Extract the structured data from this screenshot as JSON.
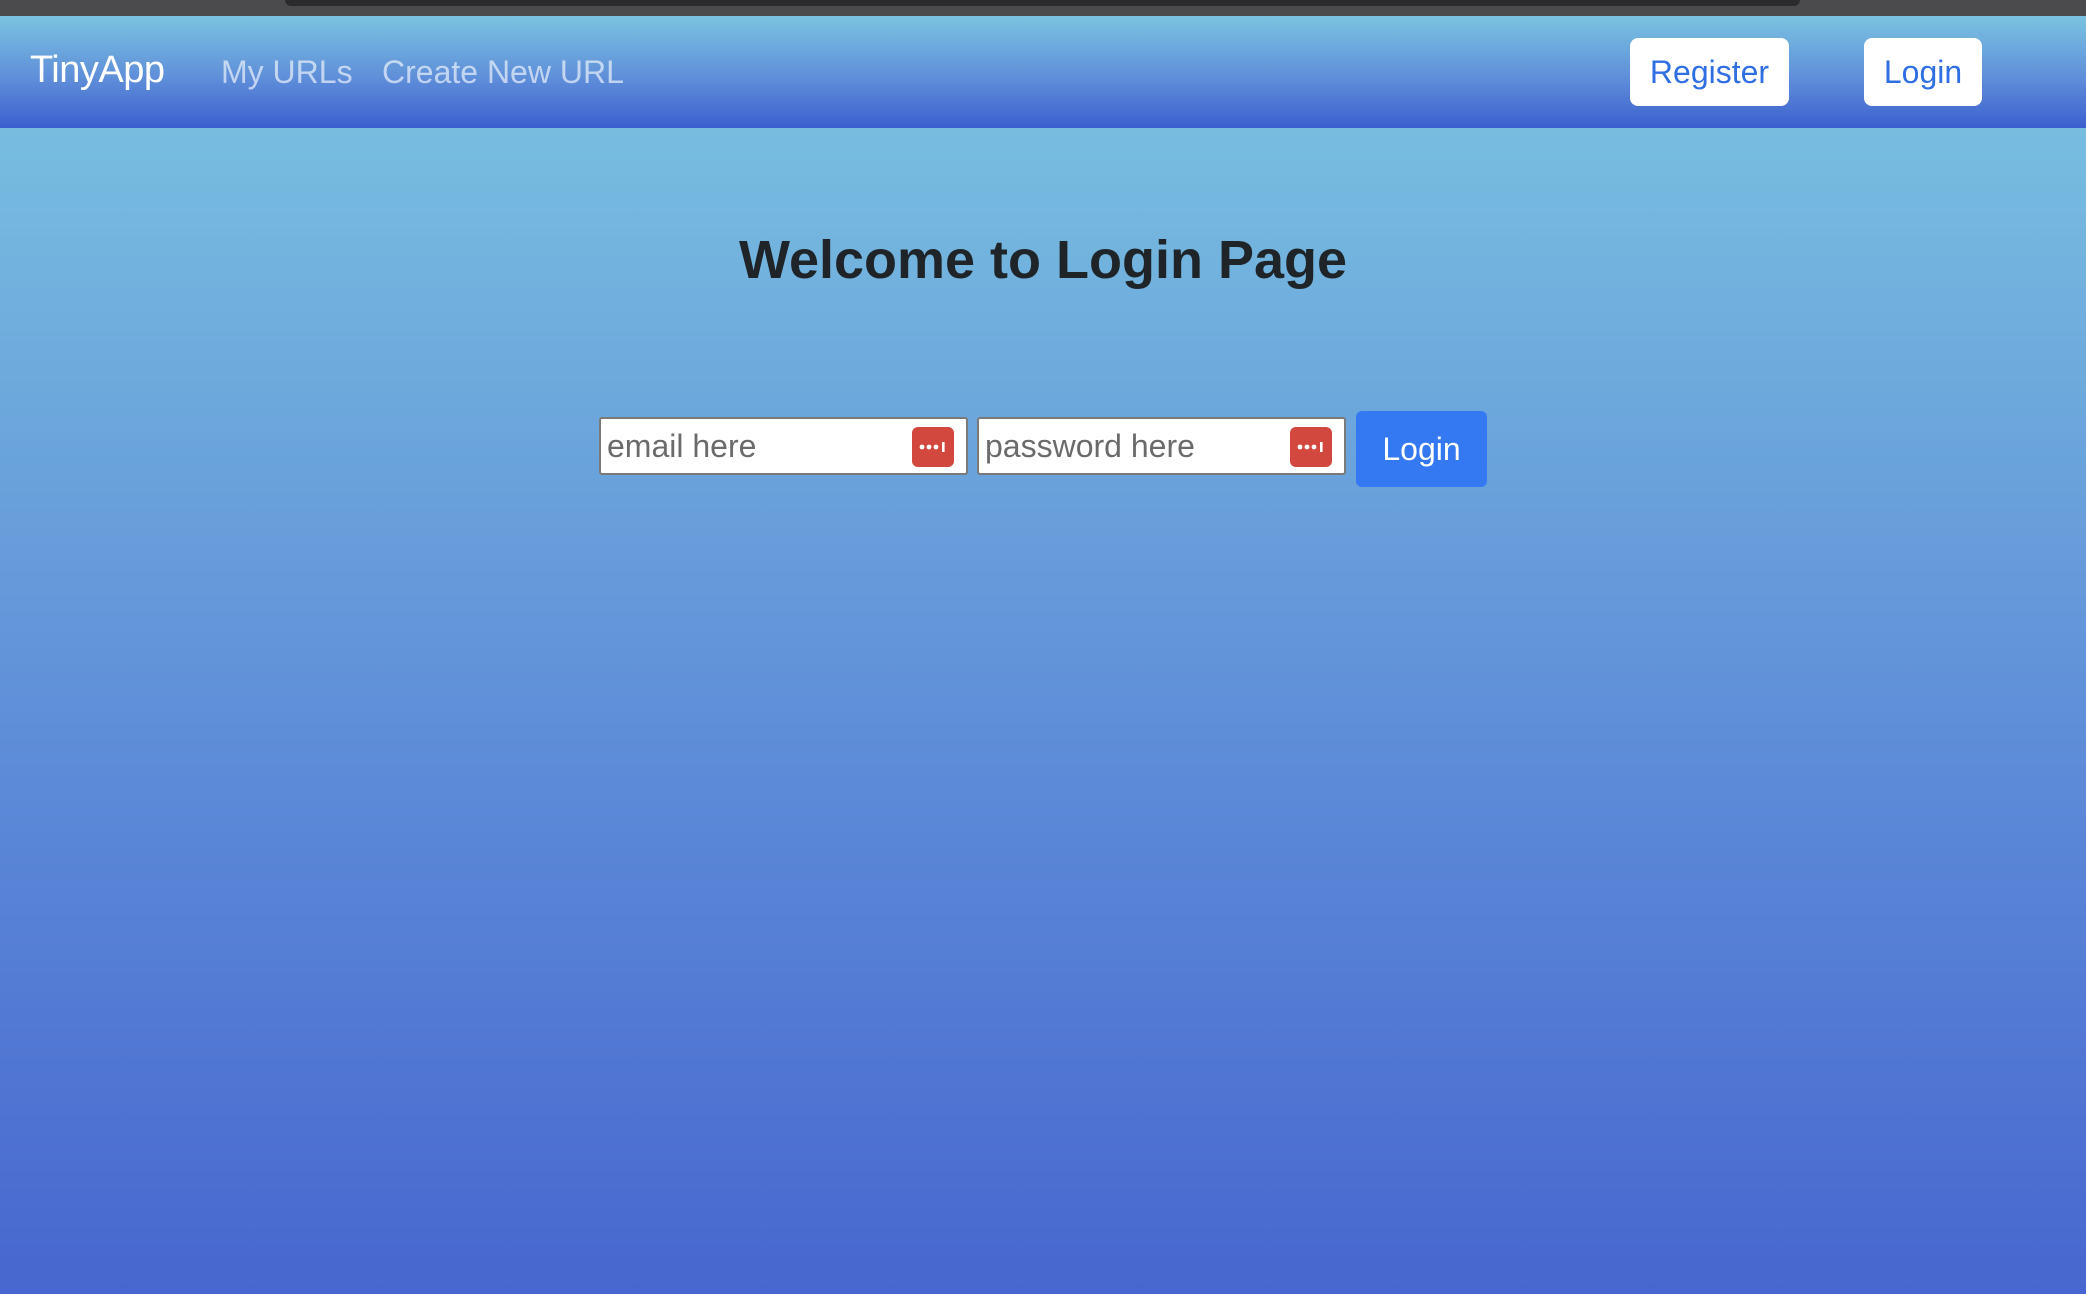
{
  "navbar": {
    "brand": "TinyApp",
    "links": [
      {
        "label": "My URLs"
      },
      {
        "label": "Create New URL"
      }
    ],
    "register_label": "Register",
    "login_label": "Login"
  },
  "main": {
    "title": "Welcome to Login Page",
    "form": {
      "email": {
        "value": "",
        "placeholder": "email here"
      },
      "password": {
        "value": "",
        "placeholder": "password here"
      },
      "submit_label": "Login"
    }
  },
  "icons": {
    "password_manager": "password-manager-icon"
  },
  "colors": {
    "primary": "#3479f1",
    "password_manager_badge": "#d2483f",
    "title": "#1f2428"
  }
}
